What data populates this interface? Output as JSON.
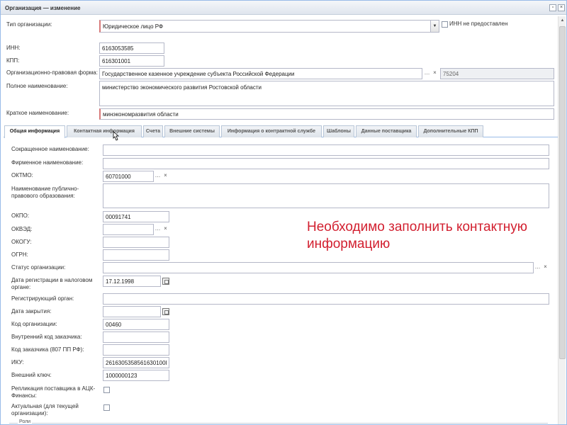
{
  "window": {
    "title": "Организация — изменение"
  },
  "header": {
    "org_type_label": "Тип организации:",
    "org_type_value": "Юридическое лицо РФ",
    "inn_not_provided_label": "ИНН не предоставлен",
    "inn_label": "ИНН:",
    "inn_value": "6163053585",
    "kpp_label": "КПП:",
    "kpp_value": "616301001",
    "legal_form_label": "Организационно-правовая форма:",
    "legal_form_value": "Государственное казенное учреждение субъекта Российской Федерации",
    "legal_form_code": "75204",
    "full_name_label": "Полное наименование:",
    "full_name_value": "министерство экономического развития Ростовской области",
    "short_name_label": "Краткое наименование:",
    "short_name_value": "минэкономразвития области"
  },
  "tabs": [
    {
      "label": "Общая информация"
    },
    {
      "label": "Контактная информация"
    },
    {
      "label": "Счета"
    },
    {
      "label": "Внешние системы"
    },
    {
      "label": "Информация о контрактной службе"
    },
    {
      "label": "Шаблоны"
    },
    {
      "label": "Данные поставщика"
    },
    {
      "label": "Дополнительные КПП"
    }
  ],
  "form": {
    "abbrev_name_label": "Сокращенное наименование:",
    "brand_name_label": "Фирменное наименование:",
    "oktmo_label": "ОКТМО:",
    "oktmo_value": "60701000",
    "public_entity_label": "Наименование публично-правового образования:",
    "okpo_label": "ОКПО:",
    "okpo_value": "00091741",
    "okved_label": "ОКВЭД:",
    "okogu_label": "ОКОГУ:",
    "ogrn_label": "ОГРН:",
    "status_label": "Статус организации:",
    "tax_reg_date_label": "Дата регистрации в налоговом органе:",
    "tax_reg_date_value": "17.12.1998",
    "reg_authority_label": "Регистрирующий орган:",
    "close_date_label": "Дата закрытия:",
    "org_code_label": "Код организации:",
    "org_code_value": "00460",
    "internal_code_label": "Внутренний код заказчика:",
    "customer_code_label": "Код заказчика (807 ПП РФ):",
    "iku_label": "ИКУ:",
    "iku_value": "2616305358561630100I",
    "external_key_label": "Внешний ключ:",
    "external_key_value": "1000000123",
    "replication_label": "Репликация поставщика в АЦК-Финансы:",
    "actual_label": "Актуальная (для текущей организации):",
    "roles_group_label": "Роли"
  },
  "notice": {
    "text": "Необходимо заполнить контактную информацию",
    "color": "#d21f2f"
  }
}
